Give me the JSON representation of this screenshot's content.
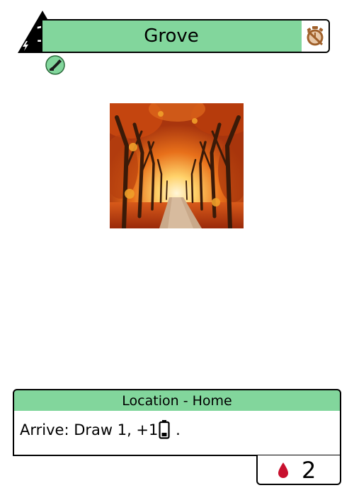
{
  "card": {
    "title": "Grove",
    "cost": "1",
    "type_line": "Location - Home",
    "rules": {
      "prefix": "Arrive: Draw 1, +1",
      "suffix": "."
    },
    "trash_cost": "2"
  },
  "icons": {
    "cost": "energy-triangle-icon",
    "bolt": "lightning-bolt-icon",
    "corner": "no-stopwatch-icon",
    "faction": "faction-badge-icon",
    "battery": "battery-icon",
    "trash": "blood-drop-icon"
  },
  "colors": {
    "accent": "#82d69c",
    "corner_icon": "#a0602a",
    "trash_drop": "#c8102e",
    "border": "#000000"
  }
}
